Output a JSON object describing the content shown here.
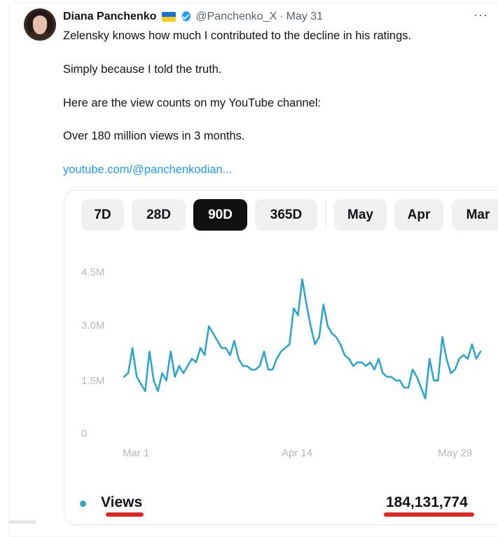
{
  "post": {
    "author_name": "Diana Panchenko",
    "handle": "@Panchenko_X",
    "separator": "·",
    "date": "May 31",
    "more_label": "···",
    "paragraphs": [
      "Zelensky knows how much I contributed to the decline in his ratings.",
      "Simply because I told the truth.",
      "Here are the view counts on my YouTube channel:",
      "Over 180 million views in 3 months."
    ],
    "link_text": "youtube.com/@panchenkodian..."
  },
  "analytics": {
    "tabs": [
      {
        "label": "7D",
        "active": false
      },
      {
        "label": "28D",
        "active": false
      },
      {
        "label": "90D",
        "active": true
      },
      {
        "label": "365D",
        "active": false
      },
      {
        "label": "May",
        "active": false
      },
      {
        "label": "Apr",
        "active": false
      },
      {
        "label": "Mar",
        "active": false
      }
    ],
    "legend_label": "Views",
    "total_views": "184,131,774",
    "colors": {
      "line": "#2ea6cb",
      "active_tab": "#111111",
      "underline": "#e8231c",
      "flag_blue": "#1f6fd1",
      "flag_yellow": "#f5cf1a",
      "verified": "#1d9bf0"
    }
  },
  "chart_data": {
    "type": "line",
    "title": "",
    "xlabel": "",
    "ylabel": "",
    "x_tick_labels": [
      "Mar 1",
      "Apr 14",
      "May 29"
    ],
    "y_tick_labels": [
      "0",
      "1.5M",
      "3.0M",
      "4.5M"
    ],
    "y_ticks": [
      0,
      1500000,
      3000000,
      4500000
    ],
    "ylim": [
      0,
      4500000
    ],
    "grid": false,
    "series": [
      {
        "name": "Views",
        "values": [
          1.6,
          1.7,
          2.4,
          1.6,
          1.4,
          1.2,
          2.3,
          1.5,
          1.2,
          1.7,
          1.5,
          2.3,
          1.6,
          1.9,
          1.7,
          1.9,
          2.1,
          2.0,
          2.4,
          2.2,
          3.0,
          2.8,
          2.6,
          2.4,
          2.4,
          2.2,
          2.6,
          2.1,
          1.9,
          1.9,
          1.8,
          1.8,
          1.9,
          2.3,
          1.8,
          1.8,
          2.1,
          2.3,
          2.4,
          2.5,
          3.5,
          3.3,
          4.3,
          3.6,
          3.0,
          2.5,
          2.7,
          3.6,
          3.0,
          2.8,
          2.7,
          2.5,
          2.2,
          2.1,
          1.9,
          2.0,
          2.0,
          1.9,
          2.0,
          1.8,
          2.1,
          1.7,
          1.6,
          1.6,
          1.5,
          1.5,
          1.3,
          1.3,
          1.8,
          1.6,
          1.3,
          1.0,
          2.1,
          1.5,
          1.5,
          2.7,
          2.1,
          1.7,
          1.8,
          2.1,
          2.2,
          2.1,
          2.5,
          2.1,
          2.3
        ],
        "unit": "millions"
      }
    ]
  }
}
